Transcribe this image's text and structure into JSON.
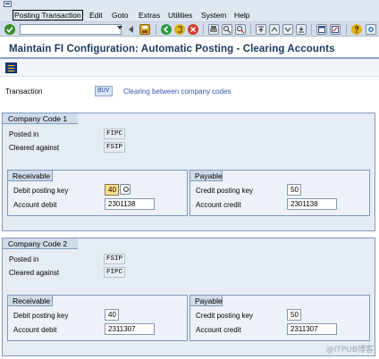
{
  "menubar": {
    "items": [
      "Posting Transaction",
      "Edit",
      "Goto",
      "Extras",
      "Utilities",
      "System",
      "Help"
    ]
  },
  "toolbar": {
    "command_field_value": "",
    "colors": {
      "enter": "#3a8e2a",
      "save": "#d9a22b",
      "back": "#2f9a44",
      "exit": "#e0b21c",
      "cancel": "#d33c2c"
    }
  },
  "title": "Maintain FI Configuration: Automatic Posting - Clearing Accounts",
  "transaction": {
    "label": "Transaction",
    "code": "BUV",
    "description": "Clearing between company codes"
  },
  "company_code_1": {
    "title": "Company Code 1",
    "posted_in_label": "Posted in",
    "posted_in": "FIPC",
    "cleared_against_label": "Cleared against",
    "cleared_against": "FSIP",
    "receivable": {
      "title": "Receivable",
      "debit_key_label": "Debit posting key",
      "debit_key": "40",
      "account_label": "Account debit",
      "account": "2301138"
    },
    "payable": {
      "title": "Payable",
      "credit_key_label": "Credit posting key",
      "credit_key": "50",
      "account_label": "Account credit",
      "account": "2301138"
    }
  },
  "company_code_2": {
    "title": "Company Code 2",
    "posted_in_label": "Posted in",
    "posted_in": "FSIP",
    "cleared_against_label": "Cleared against",
    "cleared_against": "FIPC",
    "receivable": {
      "title": "Receivable",
      "debit_key_label": "Debit posting key",
      "debit_key": "40",
      "account_label": "Account debit",
      "account": "2311307"
    },
    "payable": {
      "title": "Payable",
      "credit_key_label": "Credit posting key",
      "credit_key": "50",
      "account_label": "Account credit",
      "account": "2311307"
    }
  },
  "watermark": "@ITPUB博客"
}
